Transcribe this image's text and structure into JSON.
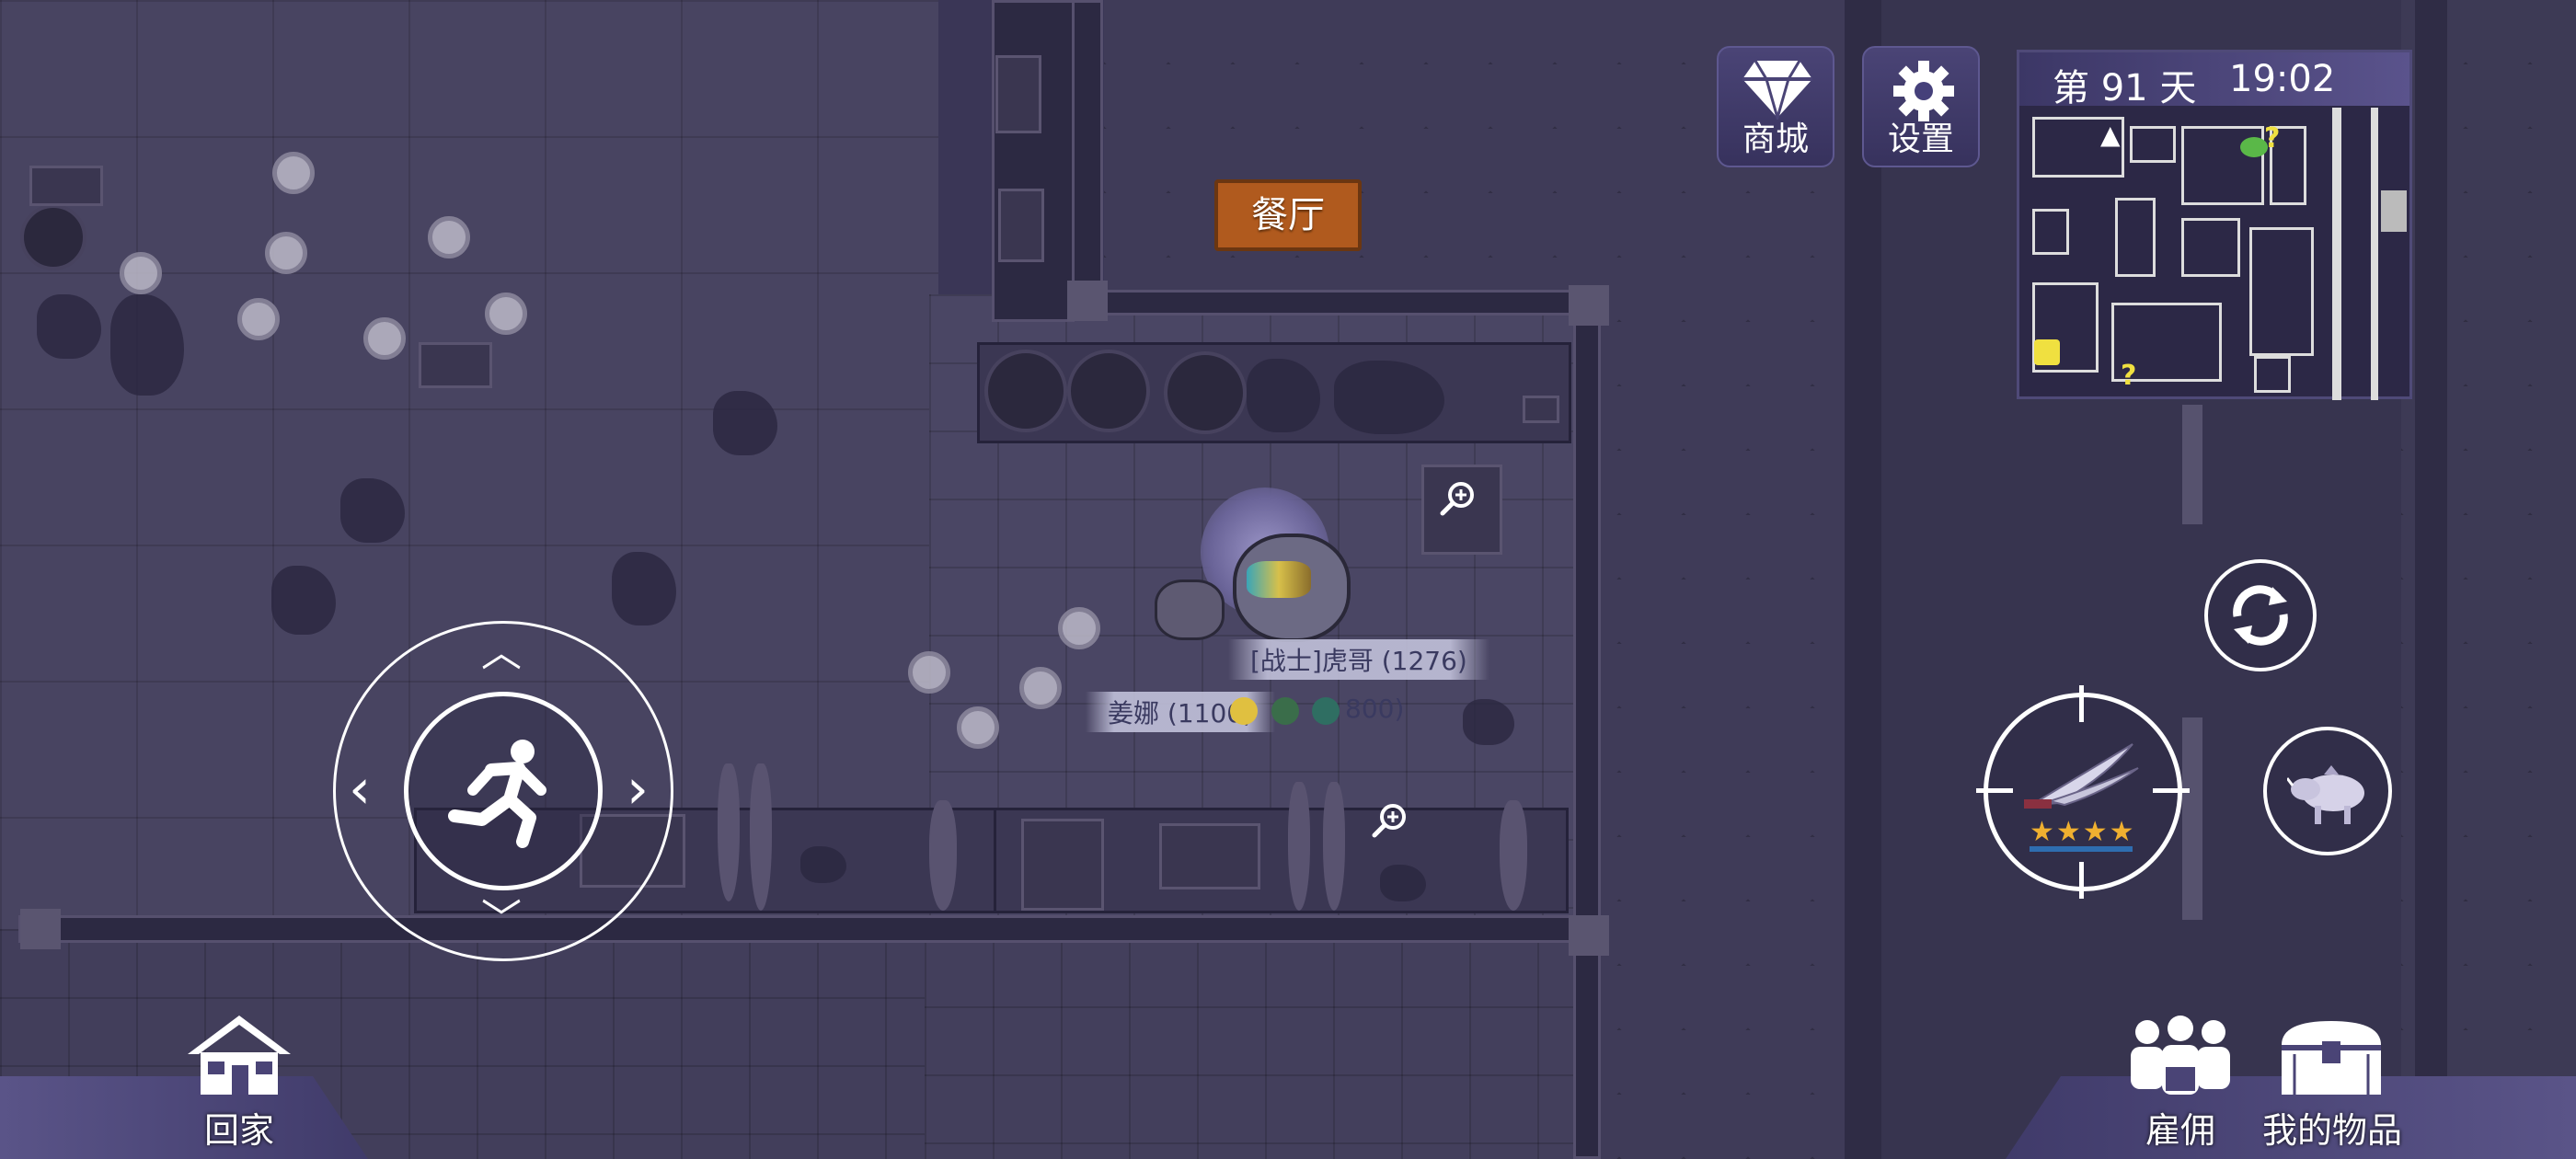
{
  "location_sign": "餐厅",
  "top_buttons": {
    "shop_label": "商城",
    "settings_label": "设置"
  },
  "minimap": {
    "day_text": "第 91 天",
    "time_text": "19:02"
  },
  "characters": [
    {
      "name_tag": "[战士]虎哥 (1276)"
    },
    {
      "name_tag": "姜娜 (1100)",
      "suffix_text": "800)"
    }
  ],
  "bottom_nav": {
    "home_label": "回家",
    "hire_label": "雇佣",
    "items_label": "我的物品"
  },
  "weapon": {
    "stars": 4
  },
  "colors": {
    "ui_panel": "#3c3766",
    "sign_bg": "#b05a1e",
    "sign_border": "#6b3611",
    "star": "#f0b030"
  }
}
